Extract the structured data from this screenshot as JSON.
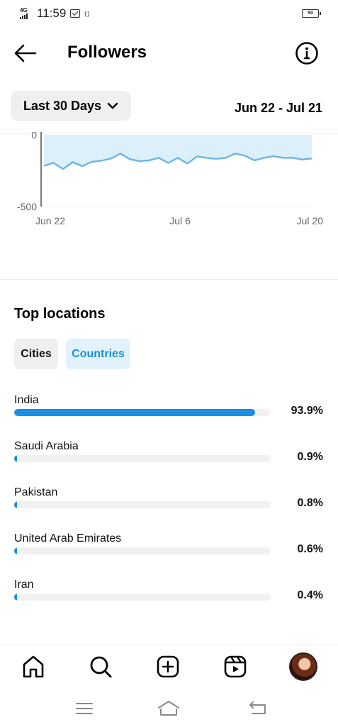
{
  "status_bar": {
    "network": "4G",
    "time": "11:59",
    "battery": "50"
  },
  "header": {
    "title": "Followers"
  },
  "filters": {
    "range_label": "Last 30 Days",
    "date_range": "Jun 22 - Jul 21"
  },
  "chart_data": {
    "type": "area",
    "ylim": [
      -500,
      0
    ],
    "y_ticks": [
      "0",
      "-500"
    ],
    "x_ticks": [
      "Jun 22",
      "Jul 6",
      "Jul 20"
    ],
    "series": [
      {
        "values": [
          -215,
          -195,
          -238,
          -190,
          -218,
          -188,
          -180,
          -165,
          -130,
          -170,
          -183,
          -178,
          -160,
          -195,
          -160,
          -200,
          -150,
          -160,
          -167,
          -160,
          -130,
          -145,
          -178,
          -160,
          -148,
          -160,
          -160,
          -172,
          -165
        ]
      }
    ],
    "colors": {
      "line": "#6cb4e8",
      "fill": "#dcf0fc"
    }
  },
  "top_locations": {
    "title": "Top locations",
    "tabs": [
      "Cities",
      "Countries"
    ],
    "selected_tab": "Countries",
    "items": [
      {
        "name": "India",
        "percent": "93.9%",
        "fraction": 0.939
      },
      {
        "name": "Saudi Arabia",
        "percent": "0.9%",
        "fraction": 0.009
      },
      {
        "name": "Pakistan",
        "percent": "0.8%",
        "fraction": 0.008
      },
      {
        "name": "United Arab Emirates",
        "percent": "0.6%",
        "fraction": 0.006
      },
      {
        "name": "Iran",
        "percent": "0.4%",
        "fraction": 0.004
      }
    ]
  },
  "bottom_nav": [
    "home-icon",
    "search-icon",
    "create-icon",
    "reels-icon",
    "profile-avatar"
  ],
  "system_nav": [
    "menu-icon",
    "home-icon",
    "back-icon"
  ],
  "colors": {
    "accent": "#1a8fe6",
    "selected_tab_bg": "#e1f2fc"
  }
}
